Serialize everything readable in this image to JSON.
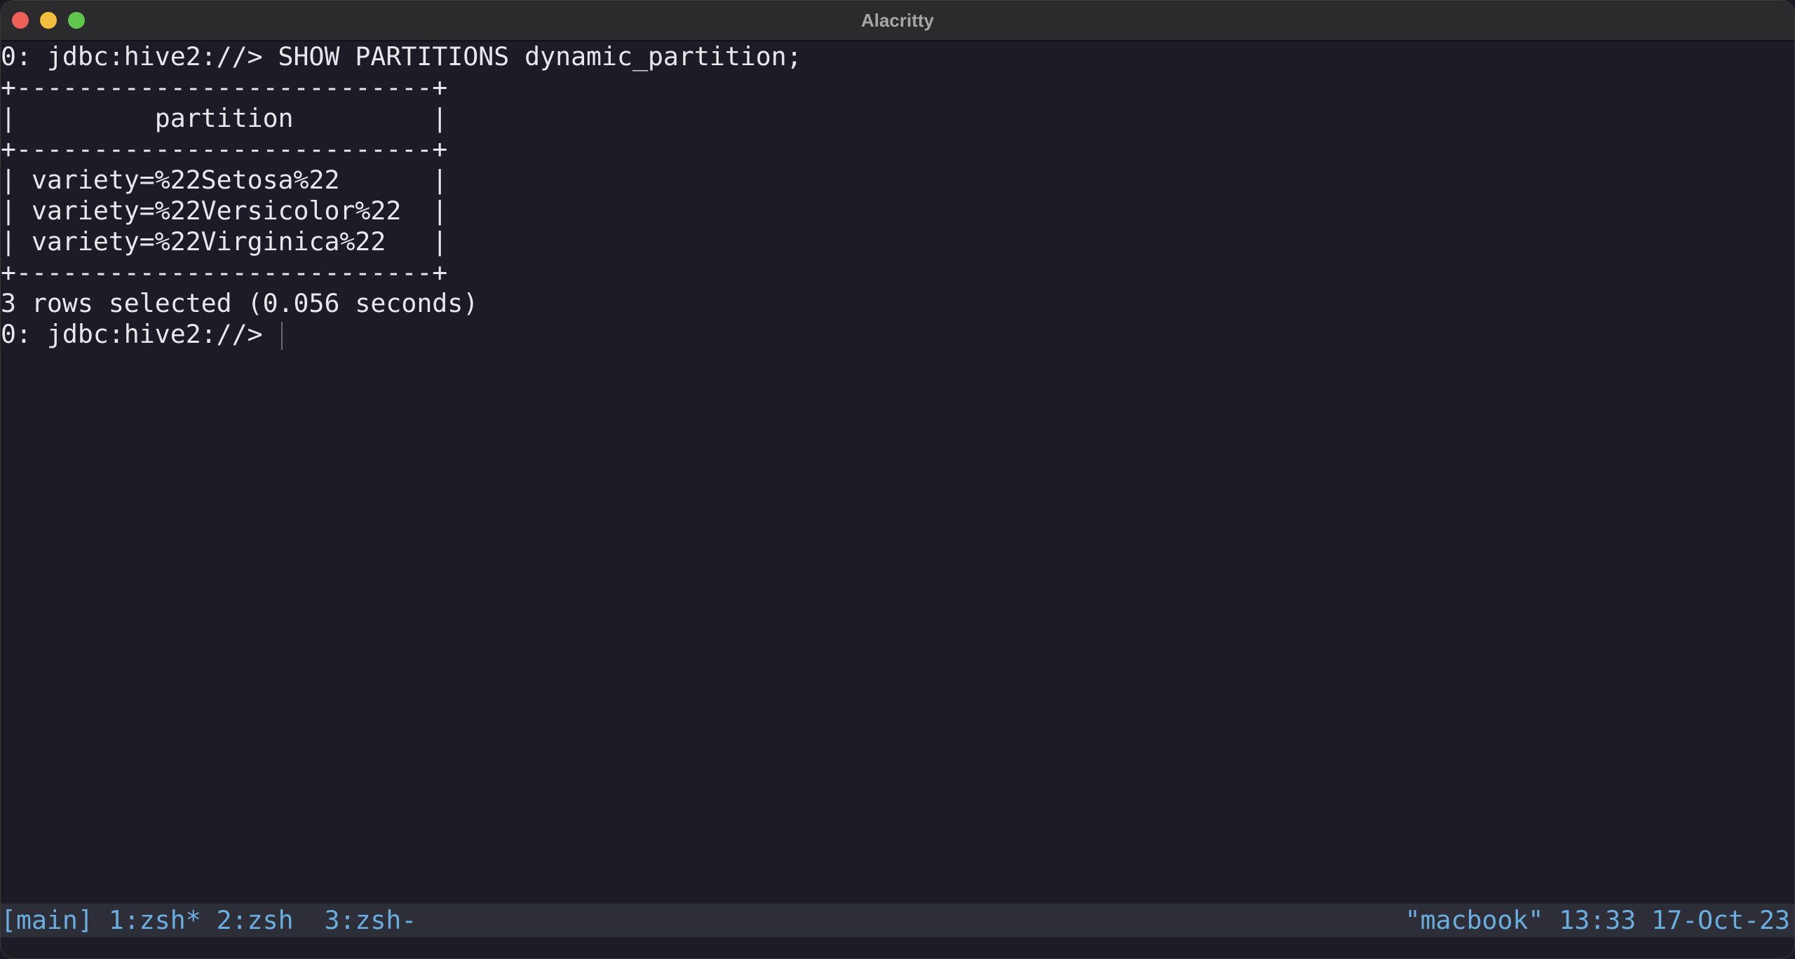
{
  "window": {
    "title": "Alacritty"
  },
  "terminal": {
    "lines": [
      "0: jdbc:hive2://> SHOW PARTITIONS dynamic_partition;",
      "+---------------------------+",
      "|         partition         |",
      "+---------------------------+",
      "| variety=%22Setosa%22      |",
      "| variety=%22Versicolor%22  |",
      "| variety=%22Virginica%22   |",
      "+---------------------------+",
      "3 rows selected (0.056 seconds)",
      "0: jdbc:hive2://> "
    ]
  },
  "statusbar": {
    "session": "[main]",
    "windows": "1:zsh* 2:zsh  3:zsh-",
    "host": "\"macbook\"",
    "time": "13:33",
    "date": "17-Oct-23"
  },
  "colors": {
    "background": "#1c1b26",
    "foreground": "#e8e8ec",
    "status_fg": "#6aaee0",
    "status_bg": "#2e2e38"
  }
}
